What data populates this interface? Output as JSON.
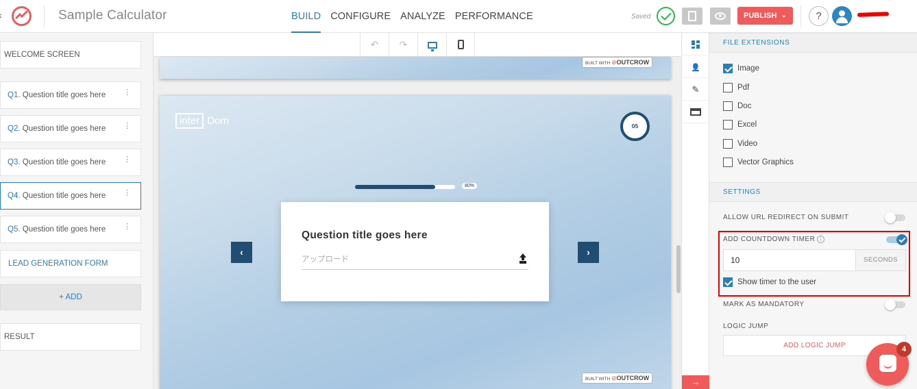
{
  "app": {
    "title": "Sample Calculator",
    "back_glyph": "‹",
    "logo_icon": "outgrow-logo-icon",
    "brand_color": "#ef5b5b",
    "accent_color": "#2a7fb8"
  },
  "nav": {
    "tabs": [
      "BUILD",
      "CONFIGURE",
      "ANALYZE",
      "PERFORMANCE"
    ],
    "active": "BUILD"
  },
  "header_actions": {
    "saved_label": "Saved",
    "publish_label": "PUBLISH",
    "publish_chevron": "⌄",
    "help_label": "?"
  },
  "left_panel": {
    "welcome_label": "WELCOME SCREEN",
    "questions": [
      {
        "num": "Q1.",
        "title": "Question title goes here"
      },
      {
        "num": "Q2.",
        "title": "Question title goes here"
      },
      {
        "num": "Q3.",
        "title": "Question title goes here"
      },
      {
        "num": "Q4.",
        "title": "Question title goes here",
        "selected": true
      },
      {
        "num": "Q5.",
        "title": "Question title goes here"
      }
    ],
    "dots_glyph": "⋮",
    "lead_form_label": "LEAD GENERATION FORM",
    "add_label": "+ ADD",
    "result_label": "RESULT"
  },
  "canvas": {
    "toolbar_icons": [
      "undo-icon",
      "redo-icon",
      "desktop-icon",
      "mobile-icon"
    ],
    "undo_glyph": "↶",
    "redo_glyph": "↷",
    "built_with_label": "BUILT WITH",
    "built_with_brand": "OUTCROW",
    "brand_logo": {
      "boxed": "inter",
      "rest": "Dom"
    },
    "timer_value": "05",
    "progress_percent": 80,
    "progress_label": "80%",
    "prev_arrow": "‹",
    "next_arrow": "›",
    "question_title": "Question title goes here",
    "upload_placeholder": "アップロード"
  },
  "rail": {
    "icons": [
      "layout-grid-icon",
      "add-user-icon",
      "pencil-icon",
      "card-icon"
    ],
    "pencil_glyph": "✎",
    "add_user_glyph": "👤",
    "next_glyph": "→"
  },
  "settings": {
    "file_extensions_header": "FILE EXTENSIONS",
    "file_types": [
      {
        "label": "Image",
        "checked": true
      },
      {
        "label": "Pdf",
        "checked": false
      },
      {
        "label": "Doc",
        "checked": false
      },
      {
        "label": "Excel",
        "checked": false
      },
      {
        "label": "Video",
        "checked": false
      },
      {
        "label": "Vector Graphics",
        "checked": false
      }
    ],
    "settings_header": "SETTINGS",
    "url_redirect_label": "ALLOW URL REDIRECT ON SUBMIT",
    "url_redirect_on": false,
    "countdown_label": "ADD COUNTDOWN TIMER",
    "countdown_on": true,
    "info_glyph": "i",
    "countdown_value": "10",
    "countdown_unit": "SECONDS",
    "show_timer_label": "Show timer to the user",
    "show_timer_checked": true,
    "mandatory_label": "MARK AS MANDATORY",
    "mandatory_on": false,
    "logic_jump_label": "LOGIC JUMP",
    "add_logic_jump_label": "ADD LOGIC JUMP",
    "highlight_color": "#e00000"
  },
  "chat": {
    "badge_count": "4"
  }
}
